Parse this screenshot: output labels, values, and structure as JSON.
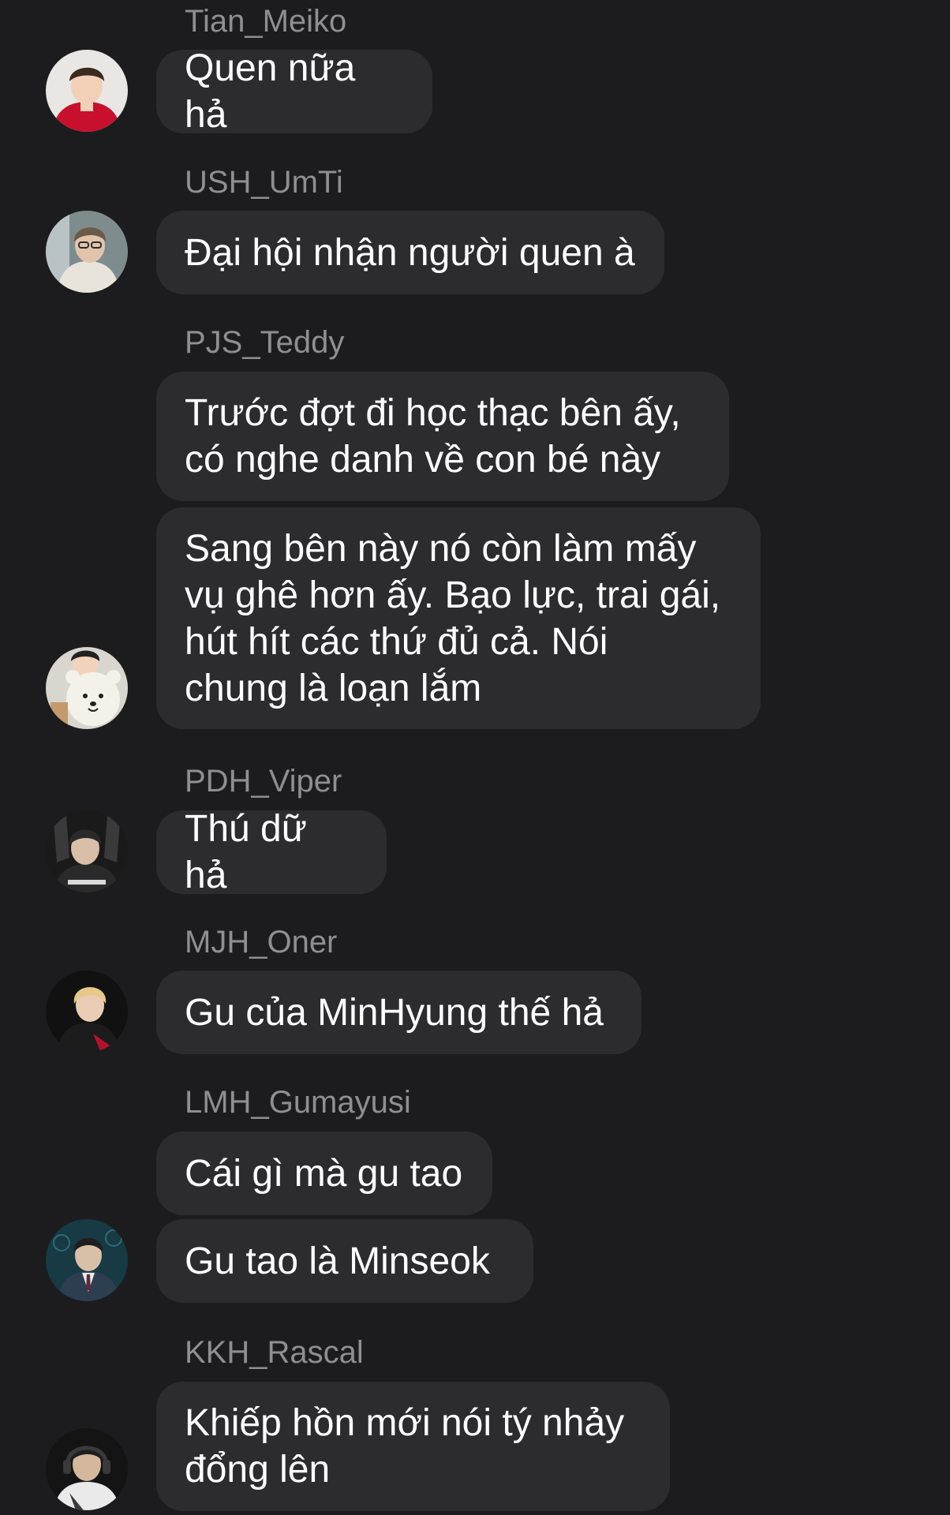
{
  "messages": [
    {
      "sender": "Tian_Meiko",
      "bubbles": [
        "Quen nữa hả"
      ]
    },
    {
      "sender": "USH_UmTi",
      "bubbles": [
        "Đại hội nhận người quen à"
      ]
    },
    {
      "sender": "PJS_Teddy",
      "bubbles": [
        "Trước đợt đi học thạc bên ấy,\ncó nghe danh về con bé này",
        "Sang bên này nó còn làm mấy\nvụ ghê hơn ấy. Bạo lực, trai gái,\nhút hít các thứ đủ cả. Nói\nchung là loạn lắm"
      ]
    },
    {
      "sender": "PDH_Viper",
      "bubbles": [
        "Thú dữ hả"
      ]
    },
    {
      "sender": "MJH_Oner",
      "bubbles": [
        "Gu của MinHyung thế hả"
      ]
    },
    {
      "sender": "LMH_Gumayusi",
      "bubbles": [
        "Cái gì mà gu tao",
        "Gu tao là Minseok"
      ]
    },
    {
      "sender": "KKH_Rascal",
      "bubbles": [
        "Khiếp hồn mới nói tý nhảy\nđổng lên"
      ]
    }
  ],
  "avatars": [
    {
      "icon": "avatar-red-jersey",
      "colors": [
        "#c8102e",
        "#f2d0b8",
        "#3a2a20"
      ]
    },
    {
      "icon": "avatar-white-hoodie",
      "colors": [
        "#e8e4dc",
        "#6b5a4a",
        "#2b2b2b"
      ]
    },
    {
      "icon": "avatar-plush-bear",
      "colors": [
        "#f4f1ea",
        "#c49a6c",
        "#222222"
      ]
    },
    {
      "icon": "avatar-dark-jersey",
      "colors": [
        "#2a2a2a",
        "#d9d9d9",
        "#1a1a1a"
      ]
    },
    {
      "icon": "avatar-blonde-jersey",
      "colors": [
        "#111111",
        "#e6c98a",
        "#b3122e"
      ]
    },
    {
      "icon": "avatar-suit",
      "colors": [
        "#173a44",
        "#2c3e50",
        "#d8c0a8"
      ]
    },
    {
      "icon": "avatar-headset",
      "colors": [
        "#141414",
        "#eaeaea",
        "#3a3a3a"
      ]
    }
  ]
}
